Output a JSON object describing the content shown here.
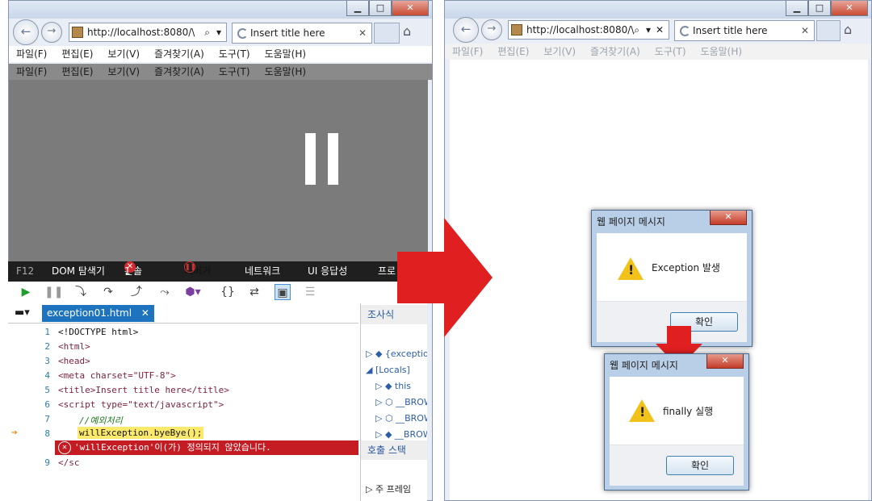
{
  "browser": {
    "address": "http://localhost:8080/\\",
    "tab_title": "Insert title here",
    "search_icon": "⌕",
    "menus": [
      "파일(F)",
      "편집(E)",
      "보기(V)",
      "즐겨찾기(A)",
      "도구(T)",
      "도움말(H)"
    ]
  },
  "devtools": {
    "tabs": [
      "F12",
      "DOM 탐색기",
      "콘솔",
      "디버거",
      "네트워크",
      "UI 응답성",
      "프로"
    ],
    "console_error_count": "1",
    "file_tab": "exception01.html",
    "code_lines": [
      {
        "n": "1",
        "t": "<!DOCTYPE html>"
      },
      {
        "n": "2",
        "t": "<html>"
      },
      {
        "n": "3",
        "t": "<head>"
      },
      {
        "n": "4",
        "t": "<meta charset=\"UTF-8\">"
      },
      {
        "n": "5",
        "t": "<title>Insert title here</title>"
      },
      {
        "n": "6",
        "t": "<script type=\"text/javascript\">"
      },
      {
        "n": "7",
        "t": "//예외처리"
      },
      {
        "n": "8",
        "t": "willException.byeBye();"
      },
      {
        "n": "9",
        "t": "</sc"
      }
    ],
    "error_message": "'willException'이(가) 정의되지 않았습니다.",
    "watch_title": "조사식",
    "watch_items": [
      "{exception",
      "[Locals]",
      "this",
      "__BROW",
      "__BROW",
      "__BROW"
    ],
    "callstack_title": "호출 스택",
    "callstack_item": "주 프레임"
  },
  "dialogs": [
    {
      "title": "웹 페이지 메시지",
      "message": "Exception 발생",
      "button": "확인"
    },
    {
      "title": "웹 페이지 메시지",
      "message": "finally 실행",
      "button": "확인"
    }
  ],
  "colors": {
    "accent_red": "#e02020",
    "error_red": "#c51c24"
  }
}
